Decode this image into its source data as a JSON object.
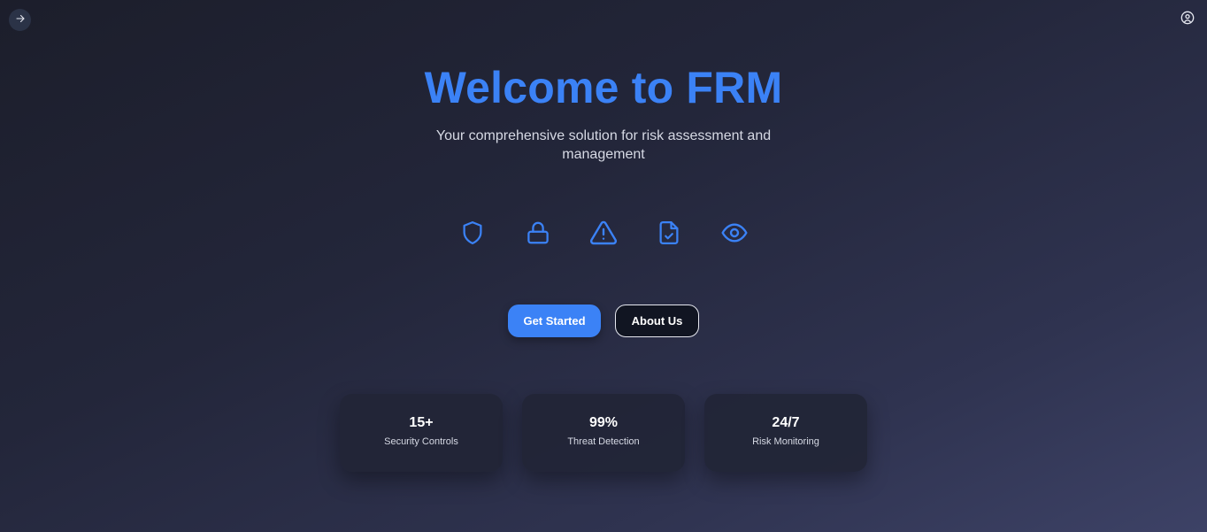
{
  "nav": {
    "left_button_icon": "arrow-right-icon",
    "right_button_icon": "user-circle-icon"
  },
  "hero": {
    "title": "Welcome to FRM",
    "subtitle": "Your comprehensive solution for risk assessment and management"
  },
  "feature_icons": [
    "shield-icon",
    "lock-icon",
    "warning-triangle-icon",
    "file-check-icon",
    "eye-icon"
  ],
  "actions": {
    "primary_label": "Get Started",
    "secondary_label": "About Us"
  },
  "stats": [
    {
      "value": "15+",
      "label": "Security Controls"
    },
    {
      "value": "99%",
      "label": "Threat Detection"
    },
    {
      "value": "24/7",
      "label": "Risk Monitoring"
    }
  ],
  "colors": {
    "accent": "#3b82f6",
    "background_start": "#1c1e2b",
    "background_end": "#3d4266",
    "card": "#222536"
  }
}
